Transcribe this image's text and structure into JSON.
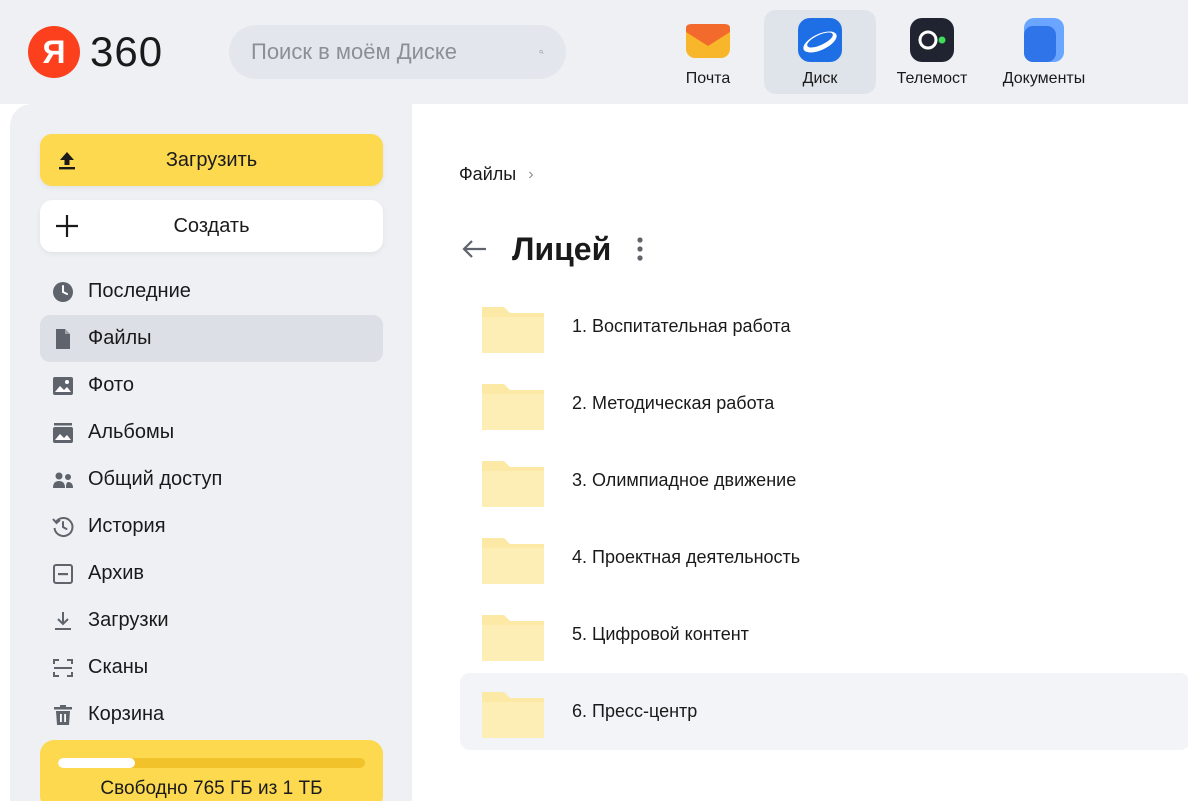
{
  "header": {
    "logo_letter": "Я",
    "logo_text": "360",
    "search_placeholder": "Поиск в моём Диске",
    "apps": [
      {
        "label": "Почта",
        "color": "#f7a21b"
      },
      {
        "label": "Диск",
        "color": "#1e6fe6",
        "active": true
      },
      {
        "label": "Телемост",
        "color": "#1f2430"
      },
      {
        "label": "Документы",
        "color": "#3f86f5"
      }
    ]
  },
  "sidebar": {
    "upload_label": "Загрузить",
    "create_label": "Создать",
    "items": [
      {
        "label": "Последние",
        "icon": "clock-icon"
      },
      {
        "label": "Файлы",
        "icon": "file-icon",
        "active": true
      },
      {
        "label": "Фото",
        "icon": "photo-icon"
      },
      {
        "label": "Альбомы",
        "icon": "album-icon"
      },
      {
        "label": "Общий доступ",
        "icon": "shared-icon"
      },
      {
        "label": "История",
        "icon": "history-icon"
      },
      {
        "label": "Архив",
        "icon": "archive-icon"
      },
      {
        "label": "Загрузки",
        "icon": "download-icon"
      },
      {
        "label": "Сканы",
        "icon": "scan-icon"
      },
      {
        "label": "Корзина",
        "icon": "trash-icon"
      }
    ],
    "storage": {
      "text": "Свободно 765 ГБ из 1 ТБ",
      "used_fraction": 0.25
    }
  },
  "main": {
    "breadcrumb": "Файлы",
    "breadcrumb_sep": "›",
    "title": "Лицей",
    "folders": [
      {
        "name": "1. Воспитательная работа"
      },
      {
        "name": "2. Методическая работа"
      },
      {
        "name": "3. Олимпиадное движение"
      },
      {
        "name": "4. Проектная деятельность"
      },
      {
        "name": "5. Цифровой контент"
      },
      {
        "name": "6. Пресс-центр",
        "selected": true
      }
    ]
  },
  "colors": {
    "accent_yellow": "#fcd94f",
    "yandex_red": "#fc3f1d",
    "folder_yellow": "#fde9a6"
  }
}
